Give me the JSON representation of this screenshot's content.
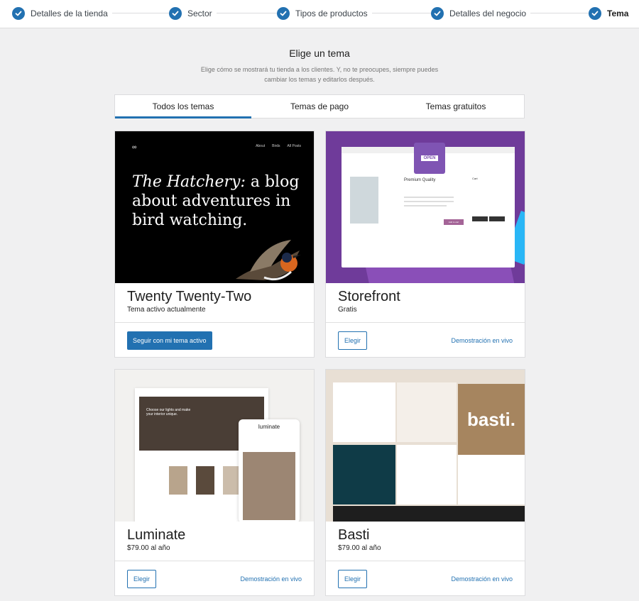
{
  "stepper": {
    "steps": [
      {
        "label": "Detalles de la tienda",
        "done": true
      },
      {
        "label": "Sector",
        "done": true
      },
      {
        "label": "Tipos de productos",
        "done": true
      },
      {
        "label": "Detalles del negocio",
        "done": true
      },
      {
        "label": "Tema",
        "done": true,
        "current": true
      }
    ]
  },
  "header": {
    "title": "Elige un tema",
    "subtitle": "Elige cómo se mostrará tu tienda a los clientes. Y, no te preocupes, siempre puedes cambiar los temas y editarlos después."
  },
  "tabs": [
    {
      "label": "Todos los temas",
      "active": true
    },
    {
      "label": "Temas de pago",
      "active": false
    },
    {
      "label": "Temas gratuitos",
      "active": false
    }
  ],
  "themes": [
    {
      "name": "Twenty Twenty-Two",
      "subtitle": "Tema activo actualmente",
      "primary_button": "Seguir con mi tema activo",
      "preview": {
        "headline_italic": "The Hatchery:",
        "headline_rest": " a blog about adventures in bird watching.",
        "logo": "∞",
        "nav": [
          "About",
          "Birds",
          "All Posts"
        ]
      }
    },
    {
      "name": "Storefront",
      "subtitle": "Gratis",
      "choose_button": "Elegir",
      "demo_link": "Demostración en vivo",
      "preview": {
        "badge": "OPEN",
        "product_title": "Premium Quality",
        "add_to_cart": "Add to cart",
        "cart": "Cart"
      }
    },
    {
      "name": "Luminate",
      "subtitle": "$79.00 al año",
      "choose_button": "Elegir",
      "demo_link": "Demostración en vivo",
      "preview": {
        "logo": "luminate",
        "hero_text": "Choose our lights and make your interior unique."
      }
    },
    {
      "name": "Basti",
      "subtitle": "$79.00 al año",
      "choose_button": "Elegir",
      "demo_link": "Demostración en vivo",
      "preview": {
        "logo": "basti."
      }
    }
  ],
  "colors": {
    "accent": "#2271b1",
    "background": "#f0f0f1",
    "storefront_purple": "#7f54b3"
  }
}
